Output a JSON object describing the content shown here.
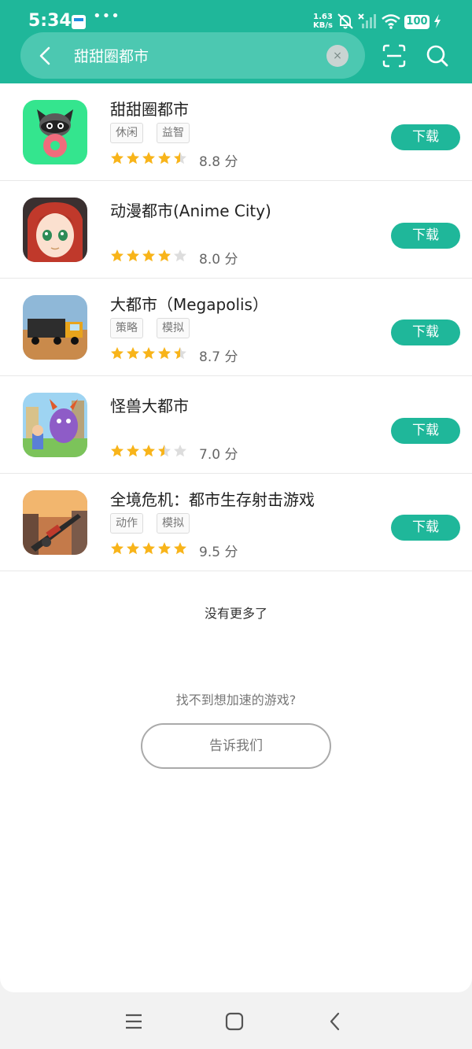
{
  "status_bar": {
    "time": "5:34",
    "net_speed_value": "1.63",
    "net_speed_unit": "KB/s",
    "battery": "100"
  },
  "search": {
    "query": "甜甜圈都市",
    "clear_label": "×"
  },
  "results": [
    {
      "title": "甜甜圈都市",
      "tags": [
        "休闲",
        "益智"
      ],
      "rating": 4.5,
      "score": "8.8 分",
      "button": "下载"
    },
    {
      "title": "动漫都市(Anime City)",
      "tags": [],
      "rating": 4,
      "score": "8.0 分",
      "button": "下载"
    },
    {
      "title": "大都市（Megapolis）",
      "tags": [
        "策略",
        "模拟"
      ],
      "rating": 4.5,
      "score": "8.7 分",
      "button": "下载"
    },
    {
      "title": "怪兽大都市",
      "tags": [],
      "rating": 3.5,
      "score": "7.0 分",
      "button": "下载"
    },
    {
      "title": "全境危机：都市生存射击游戏",
      "tags": [
        "动作",
        "模拟"
      ],
      "rating": 5,
      "score": "9.5 分",
      "button": "下载"
    }
  ],
  "footer": {
    "no_more": "没有更多了",
    "cant_find": "找不到想加速的游戏?",
    "tell_us": "告诉我们"
  },
  "colors": {
    "accent": "#1fb79a",
    "star": "#f8b41a",
    "star_empty": "#dddddd"
  },
  "icons": [
    "back-icon",
    "scan-icon",
    "search-icon",
    "menu-icon",
    "home-icon",
    "nav-back-icon"
  ]
}
